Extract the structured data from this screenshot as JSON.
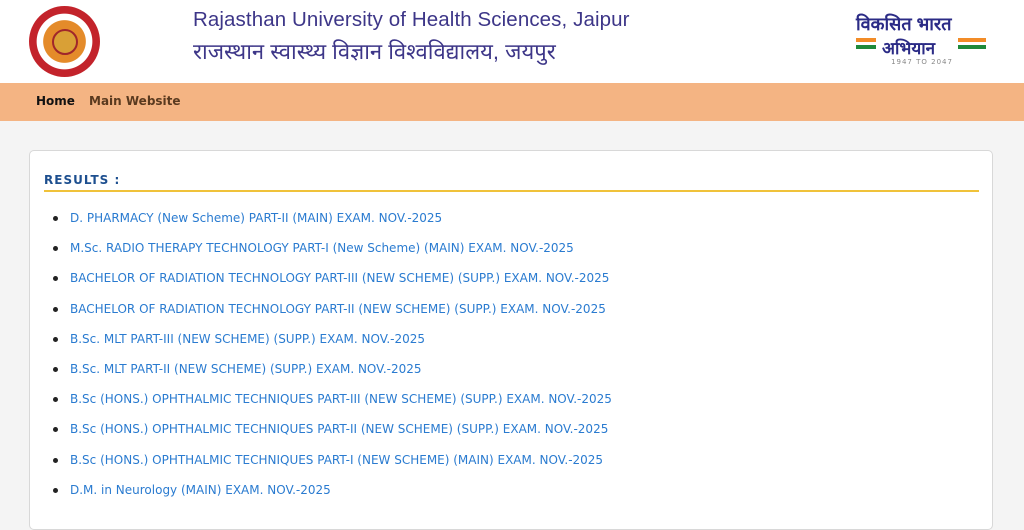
{
  "header": {
    "title_en": "Rajasthan University of Health Sciences, Jaipur",
    "title_hi": "राजस्थान स्वास्थ्य विज्ञान विश्वविद्यालय, जयपुर",
    "logo_icon": "university-seal-icon",
    "campaign": {
      "line1": "विकसित भारत",
      "line2": "अभियान",
      "years": "1947 TO 2047",
      "colors": {
        "saffron": "#f28c28",
        "green": "#1e8a3a",
        "navy": "#2b2b86"
      }
    }
  },
  "nav": {
    "background": "#f4b483",
    "items": [
      {
        "label": "Home"
      },
      {
        "label": "Main Website"
      }
    ]
  },
  "results": {
    "heading": "RESULTS :",
    "accent": "#f0c23a",
    "link_color": "#2a7bd0",
    "items": [
      "D. PHARMACY (New Scheme) PART-II (MAIN) EXAM. NOV.-2025",
      "M.Sc. RADIO THERAPY TECHNOLOGY PART-I (New Scheme) (MAIN) EXAM. NOV.-2025",
      "BACHELOR OF RADIATION TECHNOLOGY PART-III (NEW SCHEME) (SUPP.) EXAM. NOV.-2025",
      "BACHELOR OF RADIATION TECHNOLOGY PART-II (NEW SCHEME) (SUPP.) EXAM. NOV.-2025",
      "B.Sc. MLT PART-III (NEW SCHEME) (SUPP.) EXAM. NOV.-2025",
      "B.Sc. MLT PART-II (NEW SCHEME) (SUPP.) EXAM. NOV.-2025",
      "B.Sc (HONS.) OPHTHALMIC TECHNIQUES PART-III (NEW SCHEME) (SUPP.) EXAM. NOV.-2025",
      "B.Sc (HONS.) OPHTHALMIC TECHNIQUES PART-II (NEW SCHEME) (SUPP.) EXAM. NOV.-2025",
      "B.Sc (HONS.) OPHTHALMIC TECHNIQUES PART-I (NEW SCHEME) (MAIN) EXAM. NOV.-2025",
      "D.M. in Neurology (MAIN) EXAM. NOV.-2025"
    ]
  }
}
